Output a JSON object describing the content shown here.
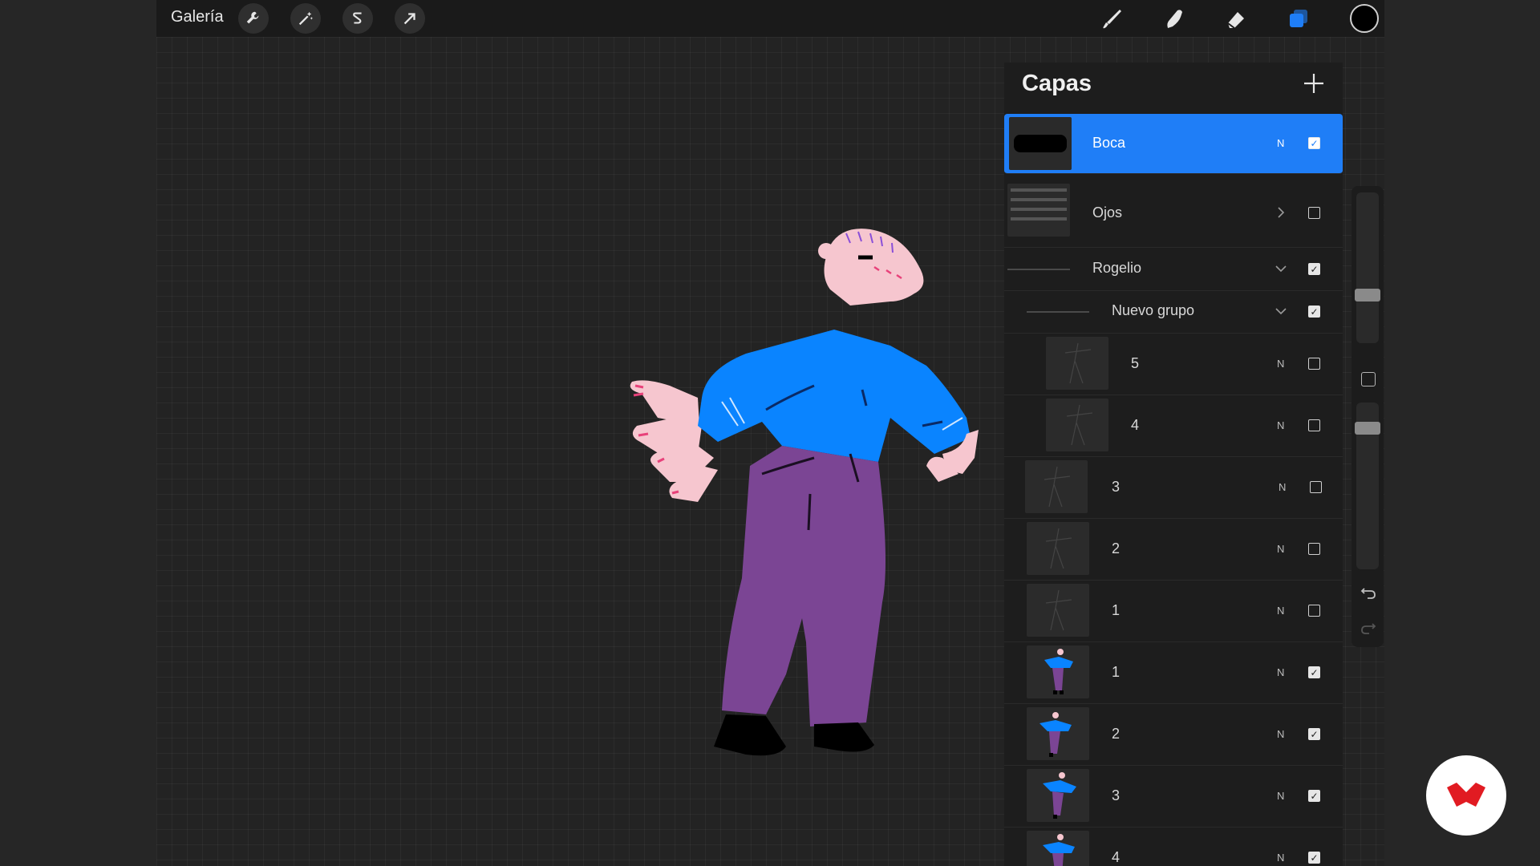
{
  "topbar": {
    "gallery_label": "Galería",
    "left_tools": [
      "wrench-icon",
      "magic-wand-icon",
      "selection-s-icon",
      "transform-arrow-icon"
    ],
    "right_tools": [
      "brush-icon",
      "smudge-icon",
      "eraser-icon",
      "layers-icon"
    ],
    "current_color": "#000000"
  },
  "layers_panel": {
    "title": "Capas",
    "add_icon": "plus-icon",
    "rows": [
      {
        "label": "Boca",
        "blend": "N",
        "checked": true,
        "selected": true
      },
      {
        "label": "Ojos",
        "blend": "",
        "checked": false,
        "group": "collapsed"
      },
      {
        "label": "Rogelio",
        "blend": "",
        "checked": true,
        "group": "expanded"
      },
      {
        "label": "Nuevo grupo",
        "blend": "",
        "checked": true,
        "group": "expanded"
      },
      {
        "label": "5",
        "blend": "N",
        "checked": false
      },
      {
        "label": "4",
        "blend": "N",
        "checked": false
      },
      {
        "label": "3",
        "blend": "N",
        "checked": false
      },
      {
        "label": "2",
        "blend": "N",
        "checked": false
      },
      {
        "label": "1",
        "blend": "N",
        "checked": false
      },
      {
        "label": "1",
        "blend": "N",
        "checked": true
      },
      {
        "label": "2",
        "blend": "N",
        "checked": true
      },
      {
        "label": "3",
        "blend": "N",
        "checked": true
      },
      {
        "label": "4",
        "blend": "N",
        "checked": true
      }
    ]
  },
  "colors": {
    "accent": "#1f7ef7",
    "sweater": "#0a84ff",
    "pants": "#7b4594",
    "skin": "#f6c6cf",
    "brand": "#e11b22"
  }
}
